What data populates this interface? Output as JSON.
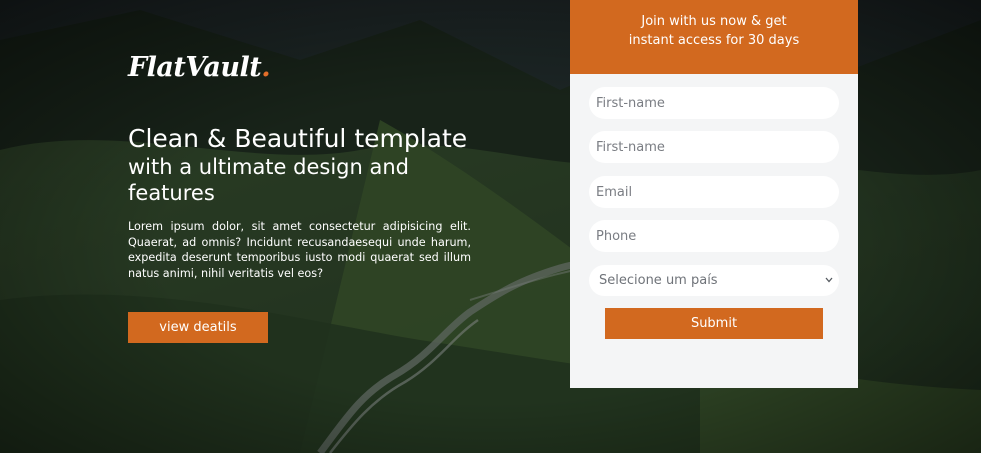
{
  "brand": {
    "name": "FlatVault",
    "dot": ".",
    "accent_color": "#d2691f"
  },
  "hero": {
    "headline_line1": "Clean & Beautiful template",
    "headline_line2": "with a ultimate design and",
    "headline_line3": "features",
    "description": "Lorem ipsum dolor, sit amet consectetur adipisicing elit. Quaerat, ad omnis? Incidunt recusandaesequi unde harum, expedita deserunt temporibus iusto modi quaerat sed illum natus animi, nihil veritatis vel eos?",
    "cta_label": "view deatils"
  },
  "form": {
    "header_line1": "Join with us now & get",
    "header_line2": "instant access for 30 days",
    "fields": [
      {
        "placeholder": "First-name"
      },
      {
        "placeholder": "First-name"
      },
      {
        "placeholder": "Email"
      },
      {
        "placeholder": "Phone"
      }
    ],
    "country_select": {
      "selected": "Selecione um país",
      "icon": "chevron-down-icon"
    },
    "submit_label": "Submit",
    "panel_color": "#f4f5f6"
  },
  "background": {
    "scene": "mountain-valley-photo",
    "overlay_color": "#0b1410"
  }
}
